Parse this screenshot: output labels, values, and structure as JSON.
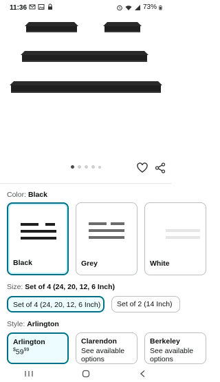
{
  "status_bar": {
    "time": "11:36",
    "battery": "73%",
    "icons": [
      "mail-icon",
      "image-icon",
      "lock-icon",
      "alarm-icon",
      "wifi-icon",
      "signal-icon",
      "battery-icon"
    ]
  },
  "gallery": {
    "dot_count": 5,
    "active_index": 0
  },
  "color": {
    "label": "Color:",
    "selected": "Black",
    "options": [
      {
        "name": "Black"
      },
      {
        "name": "Grey"
      },
      {
        "name": "White"
      }
    ]
  },
  "size": {
    "label": "Size:",
    "selected": "Set of 4 (24, 20, 12, 6 Inch)",
    "options": [
      {
        "name": "Set of 4 (24, 20, 12, 6 Inch)"
      },
      {
        "name": "Set of 2 (14 Inch)"
      }
    ]
  },
  "style": {
    "label": "Style:",
    "selected": "Arlington",
    "options": [
      {
        "name": "Arlington",
        "price_symbol": "$",
        "price_whole": "59",
        "price_fraction": "99"
      },
      {
        "name": "Clarendon",
        "availability": "See available options"
      },
      {
        "name": "Berkeley",
        "availability": "See available options"
      }
    ]
  },
  "colors": {
    "accent": "#007185",
    "shelf_black": "#1f1f1f",
    "shelf_grey": "#6b6b6b",
    "shelf_white": "#f2f2f2"
  }
}
